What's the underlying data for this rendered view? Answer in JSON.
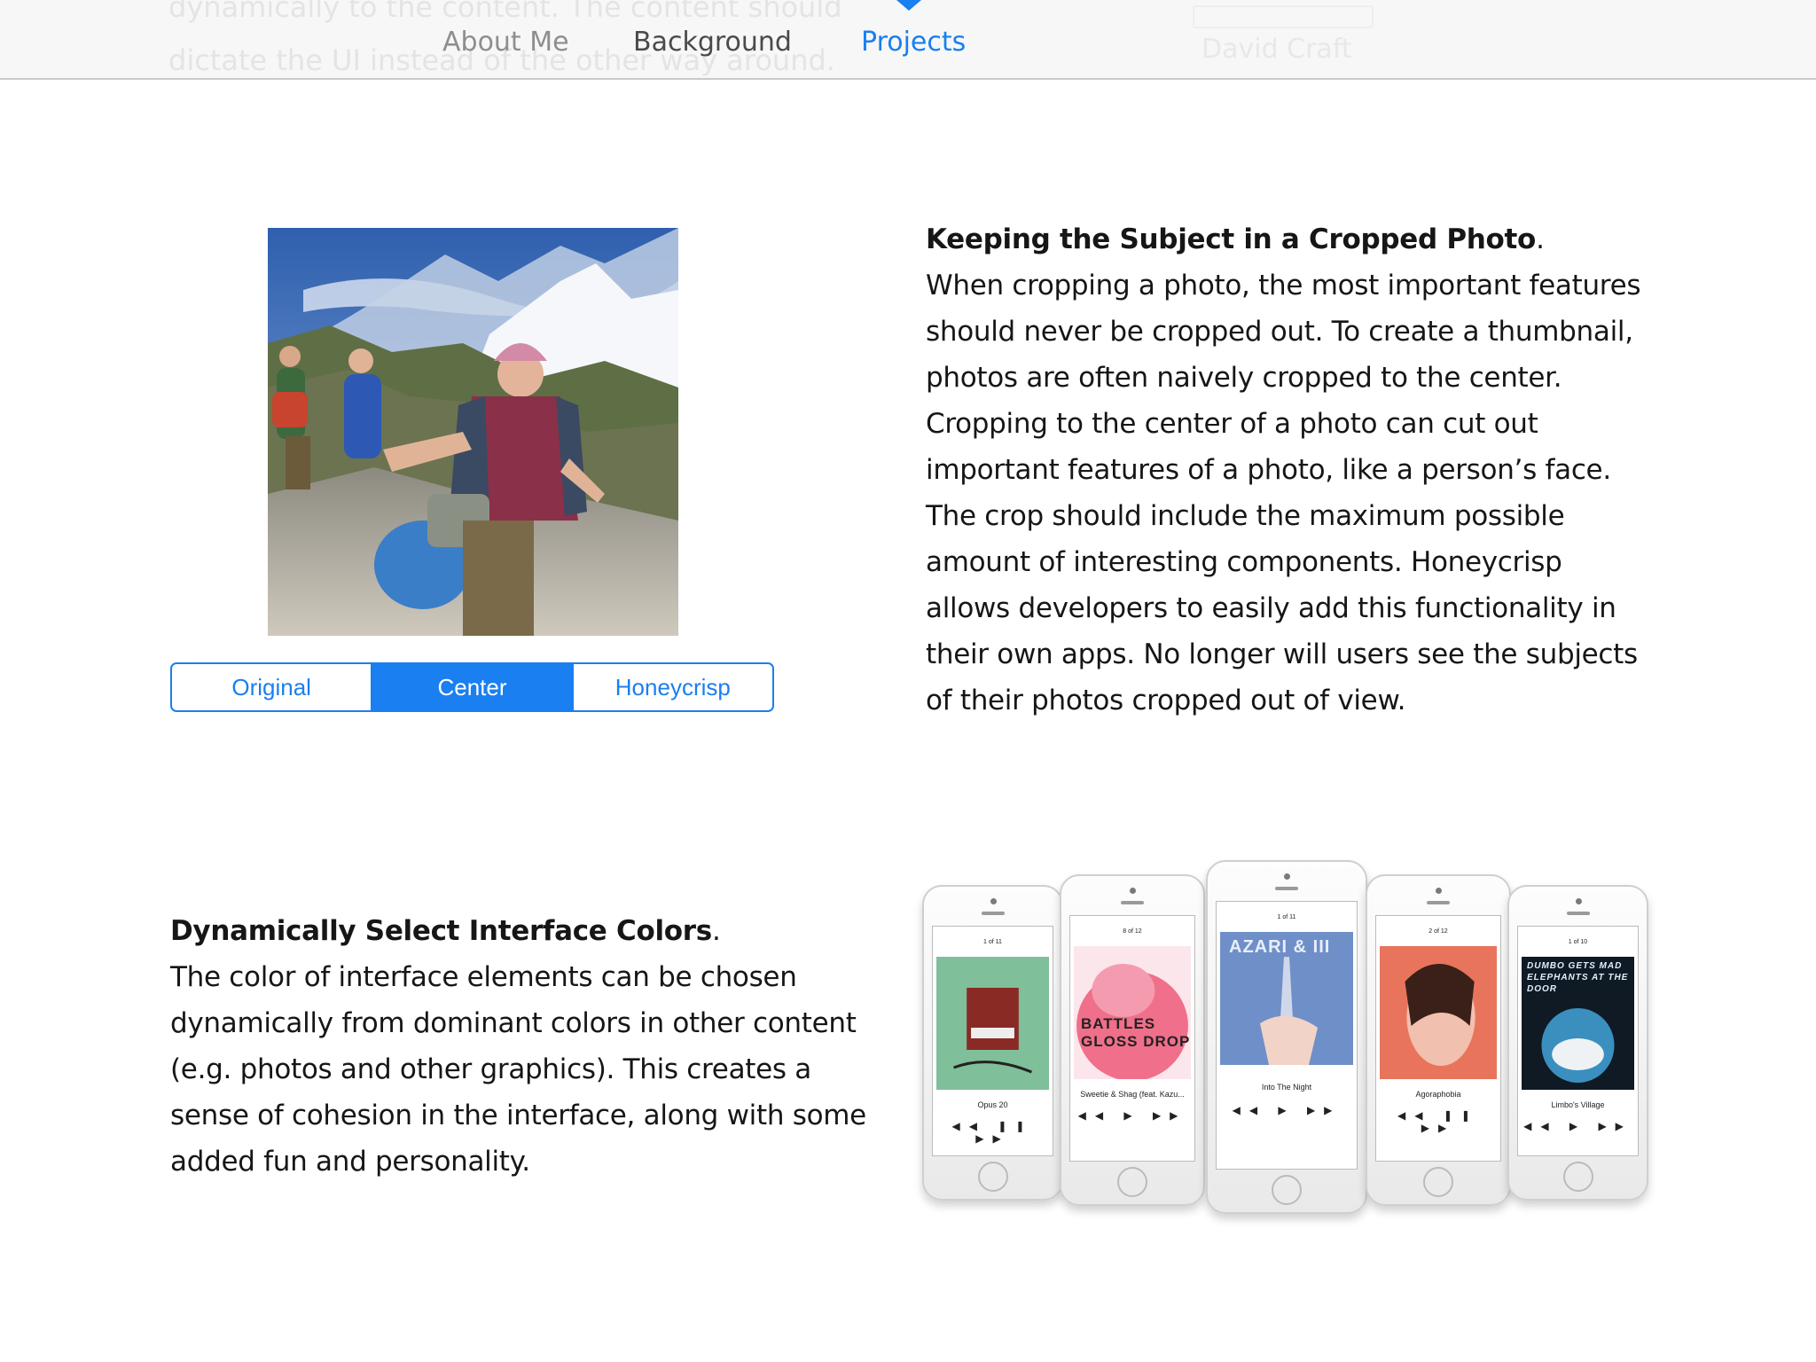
{
  "nav": {
    "ghost_line1": "dynamically to the content. The content should",
    "ghost_line2": "dictate the UI instead of the other way around.",
    "ghost_name": "David Craft",
    "items": [
      {
        "label": "About Me"
      },
      {
        "label": "Background"
      },
      {
        "label": "Projects",
        "active": true
      }
    ],
    "accent_color": "#1a7ff0"
  },
  "crop_section": {
    "title": "Keeping the Subject in a Cropped Photo",
    "body": "When cropping a photo, the most important features should never be cropped out. To create a thumbnail, photos are often naively cropped to the center. Cropping to the center of a photo can cut out important features of a photo, like a person’s face. The crop should include the maximum possible amount of interesting components. Honeycrisp allows developers to easily add this functionality in their own apps. No longer will users see the subjects of their photos cropped out of view.",
    "segments": [
      "Original",
      "Center",
      "Honeycrisp"
    ],
    "selected_segment": "Center"
  },
  "color_section": {
    "title": "Dynamically Select Interface Colors",
    "body": "The color of interface elements can be chosen dynamically from dominant colors in other content (e.g. photos and other graphics). This creates a sense of cohesion in the interface, along with some added fun and personality."
  },
  "phones": [
    {
      "track": "Opus 20",
      "count": "1 of 11",
      "color": "#7fbf9a"
    },
    {
      "track": "Sweetie & Shag (feat. Kazu...",
      "count": "8 of 12",
      "art_text": "BATTLES GLOSS DROP",
      "color": "#f06f8a"
    },
    {
      "track": "Into The Night",
      "count": "1 of 11",
      "art_text": "AZARI & III",
      "color": "#6f8fc8"
    },
    {
      "track": "Agoraphobia",
      "count": "2 of 12",
      "color": "#e9745c"
    },
    {
      "track": "Limbo's Village",
      "count": "1 of 10",
      "art_text": "DUMBO GETS MAD ELEPHANTS AT THE DOOR",
      "color": "#3a8fbf"
    }
  ]
}
